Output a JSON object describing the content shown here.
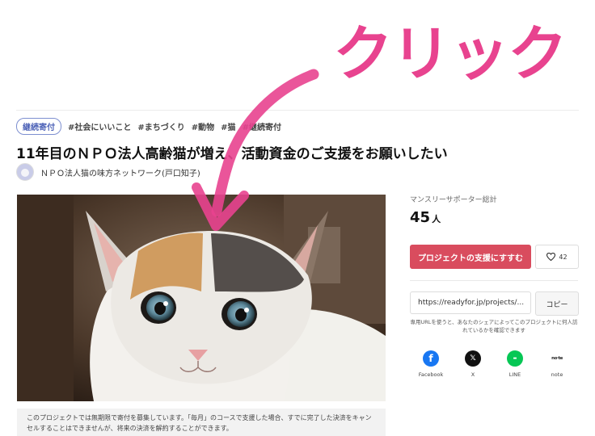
{
  "overlay": {
    "text": "クリック",
    "color": "#e8438f"
  },
  "tags": {
    "badge": "継続寄付",
    "items": [
      "#社会にいいこと",
      "#まちづくり",
      "#動物",
      "#猫",
      "#継続寄付"
    ]
  },
  "project": {
    "title": "11年目のＮＰＯ法人高齢猫が増え、活動資金のご支援をお願いしたい",
    "owner": "ＮＰＯ法人猫の味方ネットワーク(戸口知子)",
    "notice": "このプロジェクトでは無期限で寄付を募集しています。「毎月」のコースで支援した場合、すでに完了した決済をキャンセルすることはできませんが、将来の決済を解約することができます。"
  },
  "sidebar": {
    "supporters_label": "マンスリーサポーター総計",
    "supporters_count": "45",
    "supporters_unit": "人",
    "support_button": "プロジェクトの支援にすすむ",
    "like_count": "42",
    "share_url": "https://readyfor.jp/projects/...",
    "copy_button": "コピー",
    "share_note": "専用URLを使うと、あなたのシェアによってこのプロジェクトに何人訪れているかを確認できます",
    "share_options": [
      {
        "icon": "facebook-icon",
        "label": "Facebook"
      },
      {
        "icon": "x-icon",
        "label": "X"
      },
      {
        "icon": "line-icon",
        "label": "LINE"
      },
      {
        "icon": "note-icon",
        "label": "note"
      }
    ]
  },
  "colors": {
    "support_button": "#d94c5e",
    "badge_border": "#7d8fd0",
    "facebook": "#1877f2",
    "line": "#06c755"
  }
}
